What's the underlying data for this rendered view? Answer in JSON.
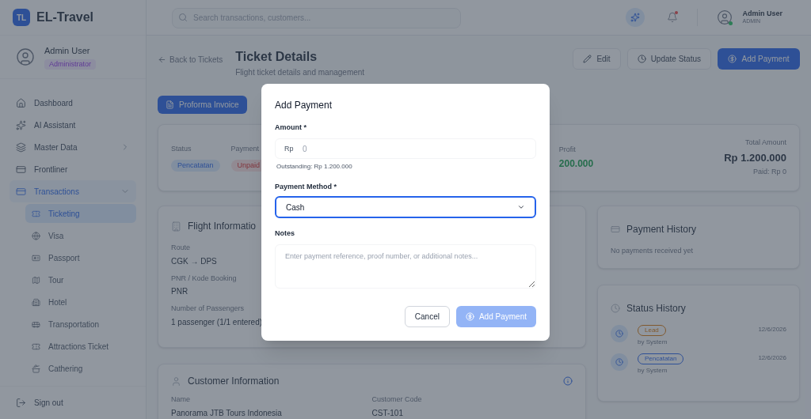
{
  "app": {
    "logo": "TL",
    "name": "EL-Travel"
  },
  "sidebar": {
    "user": {
      "name": "Admin User",
      "role": "Administrator"
    },
    "items": [
      {
        "label": "Dashboard",
        "kind": "link",
        "selected": false
      },
      {
        "label": "AI Assistant",
        "kind": "link",
        "selected": false
      },
      {
        "label": "Master Data",
        "kind": "group",
        "selected": false,
        "expanded": false
      },
      {
        "label": "Frontliner",
        "kind": "link",
        "selected": false
      },
      {
        "label": "Transactions",
        "kind": "group",
        "selected": true,
        "expanded": true,
        "children": [
          {
            "label": "Ticketing",
            "selected": true
          },
          {
            "label": "Visa",
            "selected": false
          },
          {
            "label": "Passport",
            "selected": false
          },
          {
            "label": "Tour",
            "selected": false
          },
          {
            "label": "Hotel",
            "selected": false
          },
          {
            "label": "Transportation",
            "selected": false
          },
          {
            "label": "Attractions Ticket",
            "selected": false
          },
          {
            "label": "Cathering",
            "selected": false
          }
        ]
      }
    ],
    "sign_out": "Sign out"
  },
  "header": {
    "search_placeholder": "Search transactions, customers...",
    "notification_unread": true,
    "user": {
      "name": "Admin User",
      "role": "ADMIN",
      "online": true
    }
  },
  "page": {
    "back": "Back to Tickets",
    "title": "Ticket Details",
    "subtitle": "Flight ticket details and management",
    "actions": [
      "Edit",
      "Update Status",
      "Add Payment"
    ],
    "proforma": "Proforma Invoice"
  },
  "summary": {
    "status_label": "Status",
    "status": "Pencatatan",
    "payment_label": "Payment",
    "payment": "Unpaid",
    "profit_label": "Profit",
    "profit": "200.000",
    "total_label": "Total Amount",
    "total": "Rp 1.200.000",
    "paid": "Paid: Rp 0"
  },
  "flight": {
    "title": "Flight Informatio",
    "fields": [
      {
        "label": "Route",
        "value": "CGK → DPS"
      },
      {
        "label": "PNR / Kode Booking",
        "value": "PNR"
      },
      {
        "label": "Number of Passengers",
        "value": "1 passenger (1/1 entered)"
      }
    ]
  },
  "customer": {
    "title": "Customer Information",
    "fields": [
      {
        "label": "Name",
        "value": "Panorama JTB Tours Indonesia"
      },
      {
        "label": "Customer Code",
        "value": "CST-101"
      }
    ]
  },
  "payment_history": {
    "title": "Payment History",
    "empty": "No payments received yet"
  },
  "status_history": {
    "title": "Status History",
    "entries": [
      {
        "status": "Lead",
        "color": "#80592f",
        "by": "by System",
        "date": "12/6/2026"
      },
      {
        "status": "Pencatatan",
        "color": "#2f5096",
        "by": "by System",
        "date": "12/6/2026"
      }
    ]
  },
  "dialog": {
    "title": "Add Payment",
    "amount_label": "Amount *",
    "currency": "Rp",
    "amount_placeholder": "0",
    "outstanding": "Outstanding: Rp 1.200.000",
    "method_label": "Payment Method *",
    "method": "Cash",
    "method_focused": true,
    "notes_label": "Notes",
    "notes_placeholder": "Enter payment reference, proof number, or additional notes...",
    "cancel": "Cancel",
    "submit": "Add Payment",
    "submit_disabled": true
  }
}
